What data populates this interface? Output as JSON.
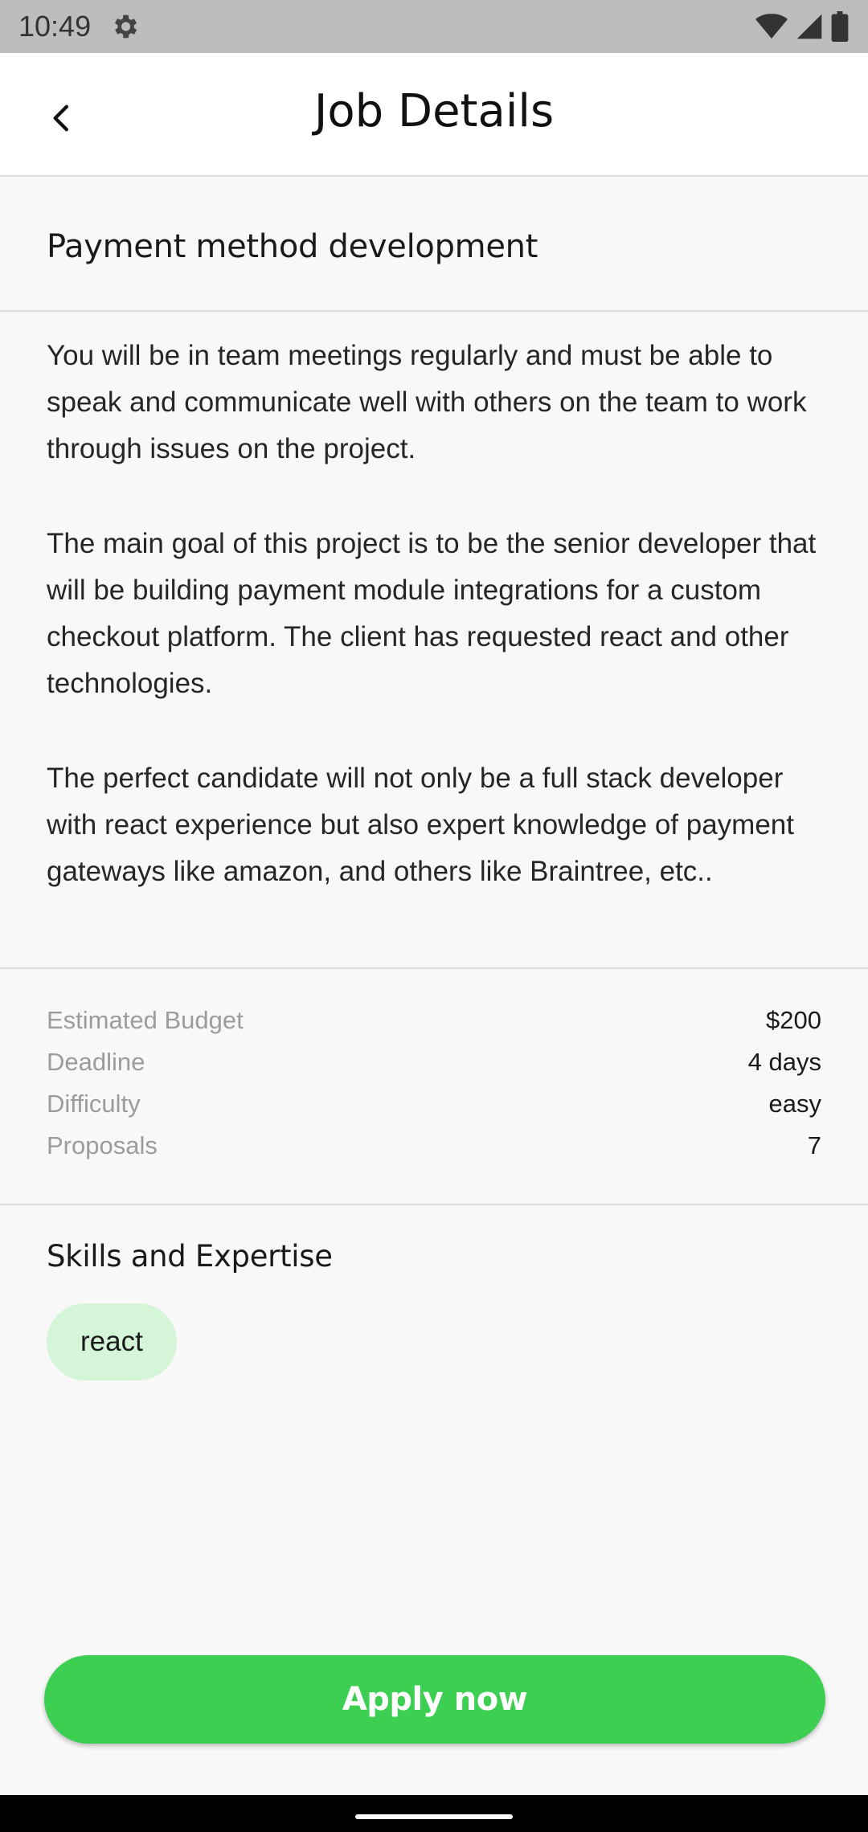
{
  "status_bar": {
    "time": "10:49",
    "icons": [
      "settings-gear-icon",
      "wifi-icon",
      "signal-icon",
      "battery-icon"
    ]
  },
  "header": {
    "title": "Job Details",
    "back_icon": "chevron-left-icon"
  },
  "job": {
    "title": "Payment method development",
    "description": [
      "You will be in team meetings regularly and must be able to speak and communicate well with others on the team to work through issues on the project.",
      "The main goal of this project is to be the senior developer that will be building payment module integrations for a custom checkout platform.  The client has requested react and other technologies.",
      "The perfect candidate will not only be a full stack developer with react experience but also expert knowledge of payment gateways like amazon, and others like Braintree, etc.."
    ],
    "details": [
      {
        "label": "Estimated Budget",
        "value": "$200"
      },
      {
        "label": "Deadline",
        "value": "4 days"
      },
      {
        "label": "Difficulty",
        "value": "easy"
      },
      {
        "label": "Proposals",
        "value": "7"
      }
    ]
  },
  "skills": {
    "title": "Skills and Expertise",
    "items": [
      "react"
    ]
  },
  "actions": {
    "apply_label": "Apply now"
  },
  "colors": {
    "accent": "#3ccf52",
    "chip_background": "#d5f5d9",
    "background": "#f8f8f8"
  }
}
